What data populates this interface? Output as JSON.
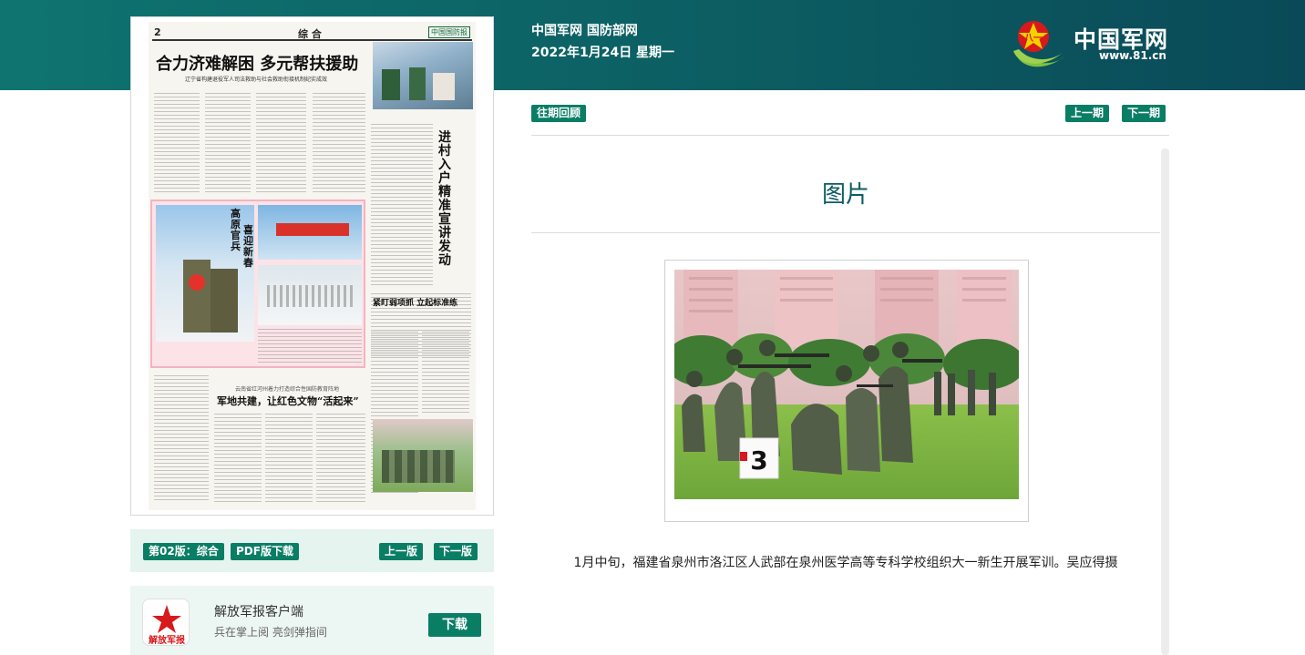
{
  "header": {
    "site_links": "中国军网 国防部网",
    "date": "2022年1月24日 星期一",
    "logo_name": "中国军网",
    "logo_url": "www.81.cn"
  },
  "newspaper": {
    "page_no": "2",
    "section": "综 合",
    "masthead": "中国国防报",
    "lead_title": "合力济难解困 多元帮扶援助",
    "lead_subtitle": "辽宁省构建退役军人司法救助与社会救助衔接机制纪实成效",
    "right_vertical_title": "进村入户精准宣讲发动",
    "photo_title_1": "高原官兵",
    "photo_title_2": "喜迎新春",
    "mid_title": "紧盯弱项抓 立起标准练",
    "banner_line": "云南省红河州着力打造综合性国防教育阵地",
    "bottom_title": "军地共建，让红色文物“活起来”"
  },
  "edition_bar": {
    "edition_label": "第02版：综合",
    "pdf_label": "PDF版下载",
    "prev_edition": "上一版",
    "next_edition": "下一版"
  },
  "client": {
    "title": "解放军报客户端",
    "subtitle": "兵在掌上阅 亮剑弹指间",
    "download": "下载",
    "icon_text": "解放军报"
  },
  "toolbar": {
    "archive": "往期回顾",
    "prev_issue": "上一期",
    "next_issue": "下一期"
  },
  "article": {
    "title": "图片",
    "caption": "1月中旬，福建省泉州市洛江区人武部在泉州医学高等专科学校组织大一新生开展军训。吴应得摄",
    "sign_number": "3"
  },
  "colors": {
    "header_start": "#0f7470",
    "header_end": "#0a4a58",
    "accent_green": "#0a7d65",
    "title_teal": "#0c5c63"
  }
}
